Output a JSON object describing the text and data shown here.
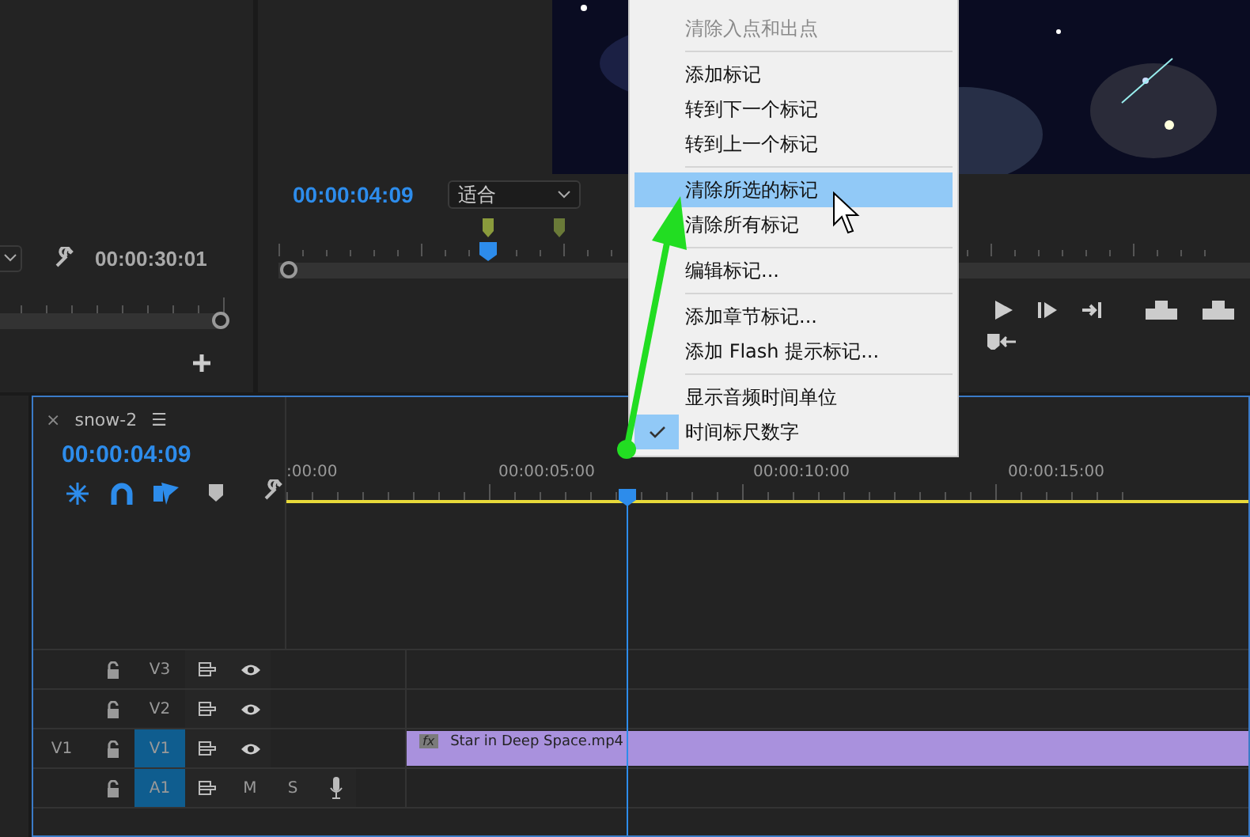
{
  "source_monitor": {
    "timecode": "00:00:30:01"
  },
  "program_monitor": {
    "timecode": "00:00:04:09",
    "zoom": "适合"
  },
  "context_menu": {
    "items": [
      {
        "kind": "item",
        "label": "清除入点和出点",
        "disabled": true,
        "selected": false,
        "checked": false
      },
      {
        "kind": "separator"
      },
      {
        "kind": "item",
        "label": "添加标记",
        "disabled": false,
        "selected": false,
        "checked": false
      },
      {
        "kind": "item",
        "label": "转到下一个标记",
        "disabled": false,
        "selected": false,
        "checked": false
      },
      {
        "kind": "item",
        "label": "转到上一个标记",
        "disabled": false,
        "selected": false,
        "checked": false
      },
      {
        "kind": "separator"
      },
      {
        "kind": "item",
        "label": "清除所选的标记",
        "disabled": false,
        "selected": true,
        "checked": false
      },
      {
        "kind": "item",
        "label": "清除所有标记",
        "disabled": false,
        "selected": false,
        "checked": false
      },
      {
        "kind": "separator"
      },
      {
        "kind": "item",
        "label": "编辑标记...",
        "disabled": false,
        "selected": false,
        "checked": false
      },
      {
        "kind": "separator"
      },
      {
        "kind": "item",
        "label": "添加章节标记...",
        "disabled": false,
        "selected": false,
        "checked": false
      },
      {
        "kind": "item",
        "label": "添加 Flash 提示标记...",
        "disabled": false,
        "selected": false,
        "checked": false
      },
      {
        "kind": "separator"
      },
      {
        "kind": "item",
        "label": "显示音频时间单位",
        "disabled": false,
        "selected": false,
        "checked": false
      },
      {
        "kind": "item",
        "label": "时间标尺数字",
        "disabled": false,
        "selected": false,
        "checked": true
      }
    ]
  },
  "timeline": {
    "close": "×",
    "tab": "snow-2",
    "menu": "☰",
    "timecode": "00:00:04:09",
    "ruler": [
      ":00:00",
      "00:00:05:00",
      "00:00:10:00",
      "00:00:15:00"
    ],
    "tracks": [
      {
        "kind": "video",
        "label": "V3",
        "targeted": false
      },
      {
        "kind": "video",
        "label": "V2",
        "targeted": false
      },
      {
        "kind": "video",
        "source": "V1",
        "label": "V1",
        "targeted": true,
        "clip": {
          "badge": "fx",
          "name": "Star in Deep Space.mp4"
        }
      },
      {
        "kind": "audio",
        "label": "A1",
        "targeted": true,
        "mute": "M",
        "solo": "S"
      }
    ]
  }
}
